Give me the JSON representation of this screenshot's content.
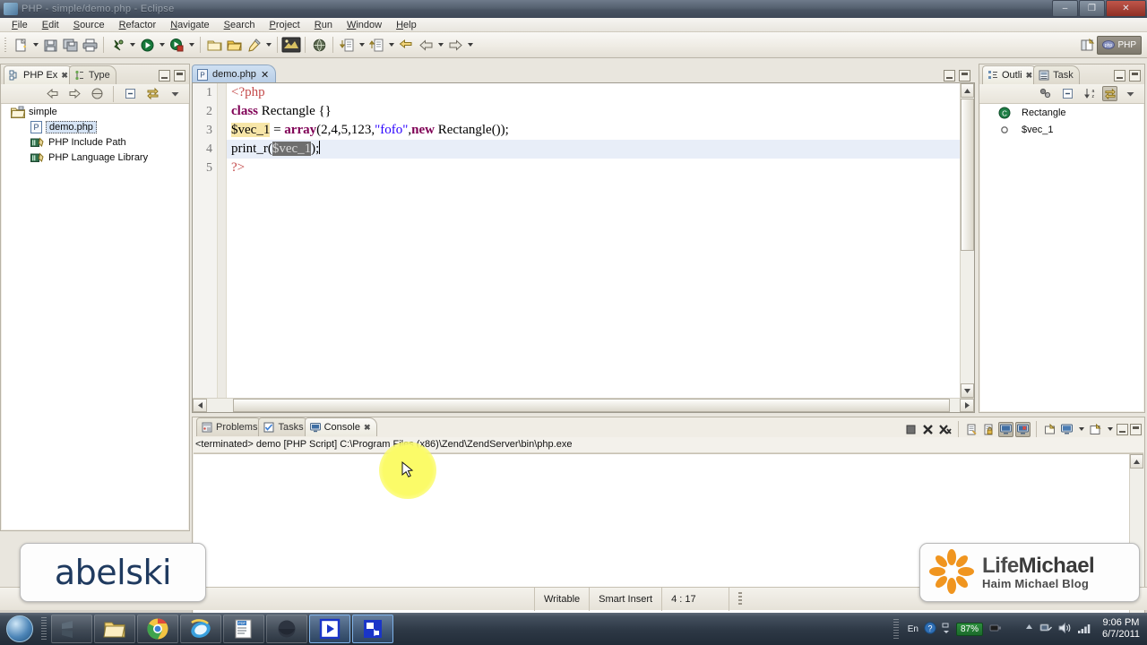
{
  "window": {
    "title": "PHP - simple/demo.php - Eclipse",
    "minimize_label": "–",
    "maximize_label": "❐",
    "close_label": "✕"
  },
  "menubar": {
    "items": [
      "File",
      "Edit",
      "Source",
      "Refactor",
      "Navigate",
      "Search",
      "Project",
      "Run",
      "Window",
      "Help"
    ]
  },
  "toolbar": {
    "buttons": [
      {
        "name": "new-wizard",
        "tooltip": "New"
      },
      {
        "name": "save",
        "tooltip": "Save"
      },
      {
        "name": "save-all",
        "tooltip": "Save All"
      },
      {
        "name": "print",
        "tooltip": "Print"
      },
      {
        "name": "debug",
        "tooltip": "Debug"
      },
      {
        "name": "run",
        "tooltip": "Run"
      },
      {
        "name": "profile",
        "tooltip": "Profile"
      },
      {
        "name": "new-php-project",
        "tooltip": "New PHP Project"
      },
      {
        "name": "open-folder",
        "tooltip": "Open"
      },
      {
        "name": "new-php-file",
        "tooltip": "New PHP File"
      },
      {
        "name": "zend-toolbar",
        "tooltip": "Zend"
      },
      {
        "name": "browser",
        "tooltip": "Open Browser"
      },
      {
        "name": "next-annotation",
        "tooltip": "Next Annotation"
      },
      {
        "name": "previous-annotation",
        "tooltip": "Previous Annotation"
      },
      {
        "name": "last-edit-location",
        "tooltip": "Last Edit Location"
      },
      {
        "name": "back",
        "tooltip": "Back"
      },
      {
        "name": "forward",
        "tooltip": "Forward"
      }
    ],
    "perspective": {
      "open_perspective_tooltip": "Open Perspective",
      "current_label": "PHP"
    }
  },
  "left_view": {
    "tabs": [
      {
        "label": "PHP Ex",
        "icon": "php-explorer-icon",
        "active": true,
        "closable": true
      },
      {
        "label": "Type",
        "icon": "type-hierarchy-icon",
        "active": false,
        "closable": false
      }
    ],
    "toolbar": [
      {
        "name": "back-icon"
      },
      {
        "name": "forward-icon"
      },
      {
        "name": "home-icon"
      },
      {
        "name": "collapse-all-icon"
      },
      {
        "name": "link-with-editor-icon"
      },
      {
        "name": "view-menu-icon"
      }
    ],
    "tree": [
      {
        "label": "simple",
        "icon": "project-folder-icon",
        "indent": 0,
        "selected": false
      },
      {
        "label": "demo.php",
        "icon": "php-file-icon",
        "indent": 1,
        "selected": true
      },
      {
        "label": "PHP Include Path",
        "icon": "library-icon",
        "indent": 1,
        "selected": false
      },
      {
        "label": "PHP Language Library",
        "icon": "library-icon",
        "indent": 1,
        "selected": false
      }
    ]
  },
  "editor": {
    "tab": {
      "label": "demo.php",
      "icon": "php-file-icon",
      "close_label": "✕",
      "dirty": false
    },
    "minimize_tooltip": "Minimize",
    "maximize_tooltip": "Maximize",
    "lines": [
      {
        "number": "1",
        "segments": [
          {
            "text": "<?php",
            "cls": "tag"
          }
        ]
      },
      {
        "number": "2",
        "segments": [
          {
            "text": "class ",
            "cls": "kw"
          },
          {
            "text": "Rectangle {}",
            "cls": "fn"
          }
        ]
      },
      {
        "number": "3",
        "segments": [
          {
            "text": "$vec_1",
            "cls": "occ"
          },
          {
            "text": " = ",
            "cls": "fn"
          },
          {
            "text": "array",
            "cls": "kw"
          },
          {
            "text": "(2,4,5,123,",
            "cls": "fn"
          },
          {
            "text": "\"fofo\"",
            "cls": "str"
          },
          {
            "text": ",",
            "cls": "fn"
          },
          {
            "text": "new ",
            "cls": "kw"
          },
          {
            "text": "Rectangle());",
            "cls": "fn"
          }
        ]
      },
      {
        "number": "4",
        "segments": [
          {
            "text": "print_r(",
            "cls": "fn"
          },
          {
            "text": "$vec_1",
            "cls": "selbox"
          },
          {
            "text": ");",
            "cls": "fn"
          }
        ],
        "current": true
      },
      {
        "number": "5",
        "segments": [
          {
            "text": "?>",
            "cls": "tag"
          }
        ]
      }
    ]
  },
  "right_view": {
    "tabs": [
      {
        "label": "Outli",
        "icon": "outline-icon",
        "active": true,
        "closable": true
      },
      {
        "label": "Task",
        "icon": "task-list-icon",
        "active": false,
        "closable": false
      }
    ],
    "toolbar": [
      {
        "name": "hide-fields-icon"
      },
      {
        "name": "collapse-all-icon"
      },
      {
        "name": "sort-icon"
      },
      {
        "name": "link-with-editor-icon"
      },
      {
        "name": "view-menu-icon"
      }
    ],
    "tree": [
      {
        "label": "Rectangle",
        "icon": "class-icon",
        "color": "#1e7f46"
      },
      {
        "label": "$vec_1",
        "icon": "variable-icon",
        "color": "#5a5a5a"
      }
    ]
  },
  "console_panel": {
    "tabs": [
      {
        "label": "Problems",
        "icon": "problems-icon",
        "active": false,
        "closable": false
      },
      {
        "label": "Tasks",
        "icon": "tasks-icon",
        "active": false,
        "closable": false
      },
      {
        "label": "Console",
        "icon": "console-icon",
        "active": true,
        "closable": true
      }
    ],
    "toolbar": [
      {
        "name": "terminate-icon"
      },
      {
        "name": "remove-launch-icon"
      },
      {
        "name": "remove-all-terminated-icon"
      },
      {
        "name": "clear-console-icon"
      },
      {
        "name": "lock-scroll-icon"
      },
      {
        "name": "scroll-lock-icon",
        "active": true
      },
      {
        "name": "show-console-on-output-icon",
        "active": true
      },
      {
        "name": "pin-console-icon"
      },
      {
        "name": "display-selected-console-icon"
      },
      {
        "name": "open-console-icon"
      },
      {
        "name": "minimize-icon"
      },
      {
        "name": "maximize-icon"
      }
    ],
    "header": "<terminated> demo [PHP Script] C:\\Program Files (x86)\\Zend\\ZendServer\\bin\\php.exe",
    "output": ""
  },
  "statusbar": {
    "writable": "Writable",
    "insert_mode": "Smart Insert",
    "position": "4 : 17"
  },
  "taskbar": {
    "start_tooltip": "Start",
    "items": [
      {
        "name": "taskbar-windows-explorer",
        "active": false
      },
      {
        "name": "taskbar-file-folder",
        "active": false
      },
      {
        "name": "taskbar-google-chrome",
        "active": false
      },
      {
        "name": "taskbar-internet-explorer",
        "active": false
      },
      {
        "name": "taskbar-pdf-reader",
        "active": false
      },
      {
        "name": "taskbar-dark-app",
        "active": false
      },
      {
        "name": "taskbar-media-player",
        "active": true
      },
      {
        "name": "taskbar-eclipse",
        "active": true
      }
    ],
    "tray": {
      "language": "En",
      "help_icon": "help-icon",
      "battery_percent": "87%",
      "network_icon": "network-icon",
      "volume_icon": "volume-icon",
      "signal_icon": "signal-icon",
      "time": "9:06 PM",
      "date": "6/7/2011"
    }
  },
  "watermarks": {
    "left": {
      "text": "abelski"
    },
    "right": {
      "brand_part1": "Life",
      "brand_part2": "Michael",
      "tagline": "Haim Michael Blog"
    }
  }
}
